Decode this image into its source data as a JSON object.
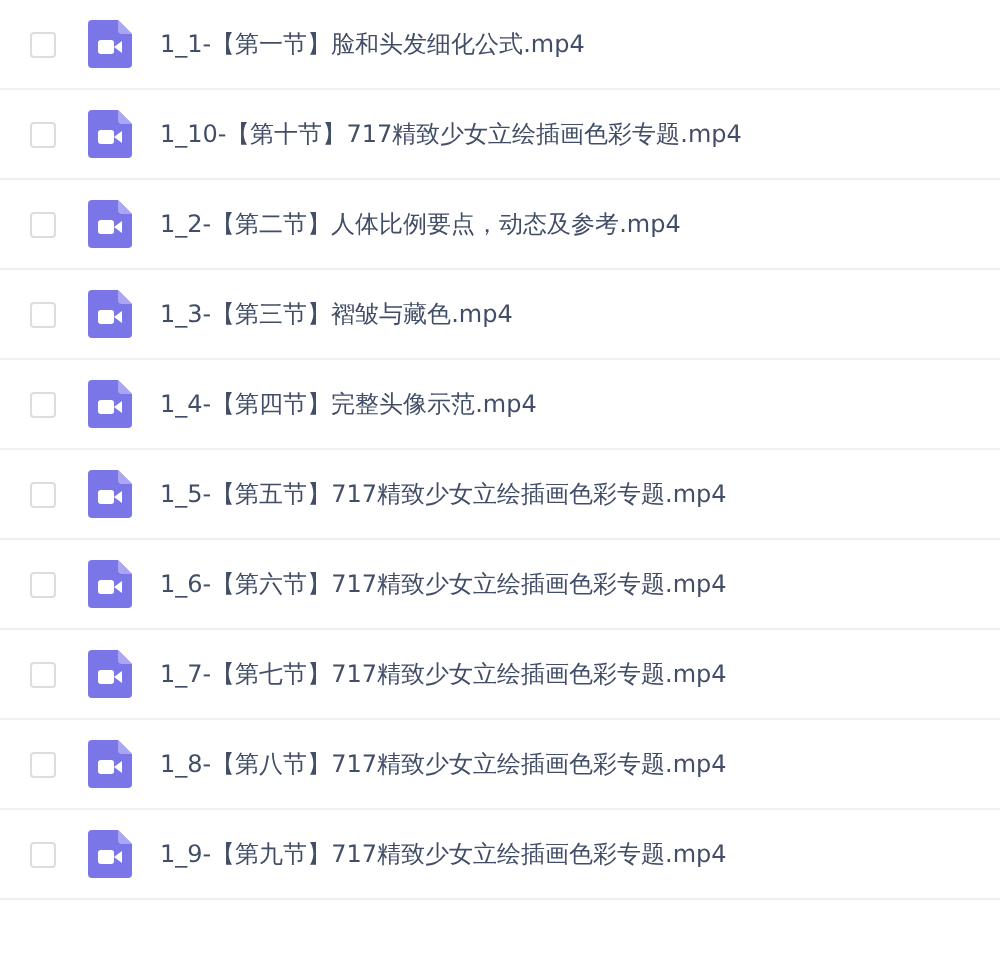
{
  "files": [
    {
      "name": "1_1-【第一节】脸和头发细化公式.mp4",
      "checked": false
    },
    {
      "name": "1_10-【第十节】717精致少女立绘插画色彩专题.mp4",
      "checked": false
    },
    {
      "name": "1_2-【第二节】人体比例要点，动态及参考.mp4",
      "checked": false
    },
    {
      "name": "1_3-【第三节】褶皱与藏色.mp4",
      "checked": false
    },
    {
      "name": "1_4-【第四节】完整头像示范.mp4",
      "checked": false
    },
    {
      "name": "1_5-【第五节】717精致少女立绘插画色彩专题.mp4",
      "checked": false
    },
    {
      "name": "1_6-【第六节】717精致少女立绘插画色彩专题.mp4",
      "checked": false
    },
    {
      "name": "1_7-【第七节】717精致少女立绘插画色彩专题.mp4",
      "checked": false
    },
    {
      "name": "1_8-【第八节】717精致少女立绘插画色彩专题.mp4",
      "checked": false
    },
    {
      "name": "1_9-【第九节】717精致少女立绘插画色彩专题.mp4",
      "checked": false
    }
  ]
}
